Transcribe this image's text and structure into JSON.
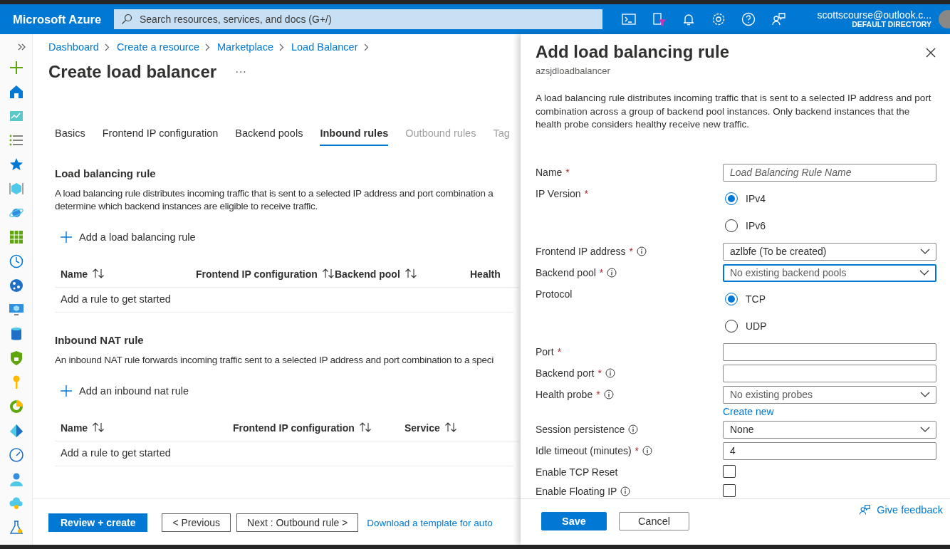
{
  "topbar": {
    "brand": "Microsoft Azure",
    "search": {
      "placeholder": "Search resources, services, and docs (G+/)"
    },
    "account": {
      "email": "scottscourse@outlook.c...",
      "directory": "DEFAULT DIRECTORY"
    }
  },
  "breadcrumb": [
    "Dashboard",
    "Create a resource",
    "Marketplace",
    "Load Balancer"
  ],
  "page": {
    "title": "Create load balancer",
    "more": "···"
  },
  "tabs": [
    {
      "label": "Basics",
      "selected": false,
      "disabled": false
    },
    {
      "label": "Frontend IP configuration",
      "selected": false,
      "disabled": false
    },
    {
      "label": "Backend pools",
      "selected": false,
      "disabled": false
    },
    {
      "label": "Inbound rules",
      "selected": true,
      "disabled": false
    },
    {
      "label": "Outbound rules",
      "selected": false,
      "disabled": true
    },
    {
      "label": "Tag",
      "selected": false,
      "disabled": true
    }
  ],
  "sections": [
    {
      "title": "Load balancing rule",
      "description": [
        "A load balancing rule distributes incoming traffic that is sent to a selected IP address and port combination a",
        "determine which backend instances are eligible to receive traffic."
      ],
      "add": "Add a load balancing rule",
      "columns": [
        {
          "label": "Name",
          "sortable": true
        },
        {
          "label": "Frontend IP configuration",
          "sortable": true
        },
        {
          "label": "Backend pool",
          "sortable": true
        },
        {
          "label": "Health",
          "sortable": false
        }
      ],
      "empty": "Add a rule to get started"
    },
    {
      "title": "Inbound NAT rule",
      "description": [
        "An inbound NAT rule forwards incoming traffic sent to a selected IP address and port combination to a speci"
      ],
      "add": "Add an inbound nat rule",
      "columns": [
        {
          "label": "Name",
          "sortable": true
        },
        {
          "label": "Frontend IP configuration",
          "sortable": true
        },
        {
          "label": "Service",
          "sortable": true
        }
      ],
      "empty": "Add a rule to get started"
    }
  ],
  "footer": {
    "buttons": [
      {
        "label": "Review + create",
        "kind": "primary"
      },
      {
        "label": "< Previous",
        "kind": "secondary"
      },
      {
        "label": "Next : Outbound rule >",
        "kind": "secondary"
      }
    ],
    "link": "Download a template for auto"
  },
  "panel": {
    "title": "Add load balancing rule",
    "subtitle": "azsjdloadbalancer",
    "description": "A load balancing rule distributes incoming traffic that is sent to a selected IP address and port combination across a group of backend pool instances. Only backend instances that the health probe considers healthy receive new traffic.",
    "required_mark": "*",
    "fields": [
      {
        "label": "Name",
        "required": true,
        "info": false,
        "kind": "text",
        "placeholder": "Load Balancing Rule Name"
      },
      {
        "label": "IP Version",
        "required": true,
        "info": false,
        "kind": "radio",
        "options": [
          {
            "label": "IPv4",
            "selected": true
          },
          {
            "label": "IPv6",
            "selected": false
          }
        ]
      },
      {
        "label": "Frontend IP address",
        "required": true,
        "info": true,
        "kind": "select",
        "value": "azlbfe (To be created)",
        "focused": false
      },
      {
        "label": "Backend pool",
        "required": true,
        "info": true,
        "kind": "select",
        "placeholder": "No existing backend pools",
        "focused": true
      },
      {
        "label": "Protocol",
        "required": false,
        "info": false,
        "kind": "radio",
        "options": [
          {
            "label": "TCP",
            "selected": true
          },
          {
            "label": "UDP",
            "selected": false
          }
        ]
      },
      {
        "label": "Port",
        "required": true,
        "info": false,
        "kind": "text"
      },
      {
        "label": "Backend port",
        "required": true,
        "info": true,
        "kind": "text"
      },
      {
        "label": "Health probe",
        "required": true,
        "info": true,
        "kind": "select",
        "placeholder": "No existing probes",
        "focused": false,
        "link": "Create new"
      },
      {
        "label": "Session persistence",
        "required": false,
        "info": true,
        "kind": "select",
        "value": "None",
        "focused": false
      },
      {
        "label": "Idle timeout (minutes)",
        "required": true,
        "info": true,
        "kind": "text",
        "value": "4"
      },
      {
        "label": "Enable TCP Reset",
        "required": false,
        "info": false,
        "kind": "checkbox",
        "checked": false
      },
      {
        "label": "Enable Floating IP",
        "required": false,
        "info": true,
        "kind": "checkbox",
        "checked": false
      }
    ],
    "buttons": [
      {
        "label": "Save",
        "kind": "primary"
      },
      {
        "label": "Cancel",
        "kind": "secondary"
      }
    ],
    "feedback": "Give feedback"
  }
}
